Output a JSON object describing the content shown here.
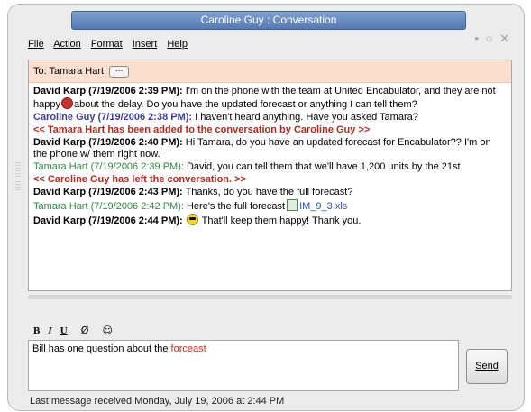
{
  "window": {
    "title": "Caroline Guy : Conversation",
    "controls": "• ○ ✕"
  },
  "menu": {
    "items": [
      "File",
      "Action",
      "Format",
      "Insert",
      "Help"
    ]
  },
  "recipients": {
    "label": "To: Tamara Hart",
    "more": "···"
  },
  "messages": [
    {
      "sender": "David Karp (7/19/2006 2:39 PM):",
      "text_a": " I'm on the phone with the team at United Encabulator, and they are not happy",
      "text_b": "about the delay.  Do you have the updated forecast or anything I can tell them?"
    },
    {
      "sender": "Caroline Guy (7/19/2006 2:38 PM):",
      "text": " I haven't heard anything. Have you asked Tamara?"
    },
    {
      "system": "<< Tamara Hart  has been added to the conversation by Caroline Guy >>"
    },
    {
      "sender": "David Karp (7/19/2006 2:40 PM):",
      "text": " Hi Tamara, do you have an updated forecast for Encabulator?? I'm on the phone w/ them right now."
    },
    {
      "sender": "Tamara Hart (7/19/2006 2:39 PM):",
      "text": " David, you can tell them that we'll have 1,200 units by the 21st"
    },
    {
      "system": "<< Caroline Guy has left the conversation. >>"
    },
    {
      "sender": "David Karp (7/19/2006 2:43 PM):",
      "text": " Thanks, do you have the full forecast?"
    },
    {
      "sender": "Tamara Hart (7/19/2006 2:42 PM):",
      "text": " Here's the full forecast",
      "file": "IM_9_3.xls"
    },
    {
      "sender": "David Karp (7/19/2006 2:44 PM):",
      "text": "That'll keep them happy!  Thank you."
    }
  ],
  "icons": {
    "angry": "angry-emoticon-icon",
    "cool": "sunglasses-emoticon-icon",
    "file": "excel-file-icon",
    "attach": "paperclip-icon"
  },
  "format": {
    "bold": "B",
    "italic": "I",
    "underline": "U",
    "attach": "Ø",
    "emoticon": "☺"
  },
  "compose": {
    "text_prefix": "Bill has one question about the ",
    "misspelled": "forceast"
  },
  "send_button": {
    "label": "Send"
  },
  "status": {
    "text": "Last message received Monday, July 19, 2006 at 2:44 PM"
  },
  "colors": {
    "david": "#000000",
    "caroline": "#3c3c9c",
    "tamara": "#2f8a44",
    "system": "#b02a1d",
    "typo": "#d12b1f",
    "recipient_bar": "#fbe0cf"
  }
}
